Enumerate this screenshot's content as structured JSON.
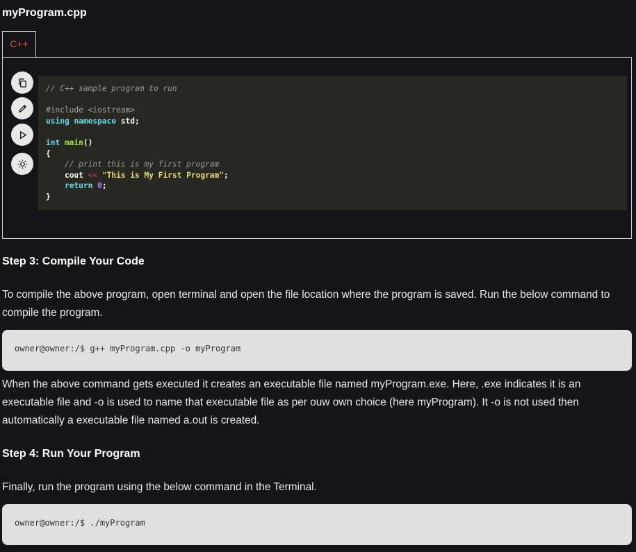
{
  "file_title": "myProgram.cpp",
  "code_tab": {
    "label": "C++",
    "color": "#e05a2a"
  },
  "toolbar": {
    "buttons": [
      {
        "icon": "copy-icon"
      },
      {
        "icon": "edit-icon"
      },
      {
        "icon": "run-icon"
      },
      {
        "icon": "theme-toggle-icon"
      }
    ]
  },
  "code": {
    "comment1": "// C++ sample program to run",
    "include": "#include <iostream>",
    "using_kw1": "using",
    "using_kw2": "namespace",
    "using_rest": " std;",
    "int_kw": "int",
    "main_fn": "main",
    "main_rest": "()",
    "open_brace": "{",
    "comment2": "// print this is my first program",
    "cout": "cout",
    "shift_op": "<<",
    "string": "\"This is My First Program\"",
    "semicolon": ";",
    "return_kw": "return",
    "zero": "0",
    "close_brace": "}"
  },
  "step3": {
    "heading": "Step 3: Compile Your Code",
    "paragraph": "To compile the above program, open terminal and open the file location where the program is saved. Run the below command to compile the program.",
    "command": "owner@owner:/$ g++ myProgram.cpp -o myProgram",
    "after": "When the above command gets executed it creates an executable file named myProgram.exe. Here, .exe indicates it is an executable file and -o is used to name that executable file as per ouw own choice (here myProgram). It -o is not used then automatically a executable file named a.out is created."
  },
  "step4": {
    "heading": "Step 4: Run Your Program",
    "paragraph": "Finally, run the program using the below command in the Terminal.",
    "command": "owner@owner:/$ ./myProgram"
  }
}
